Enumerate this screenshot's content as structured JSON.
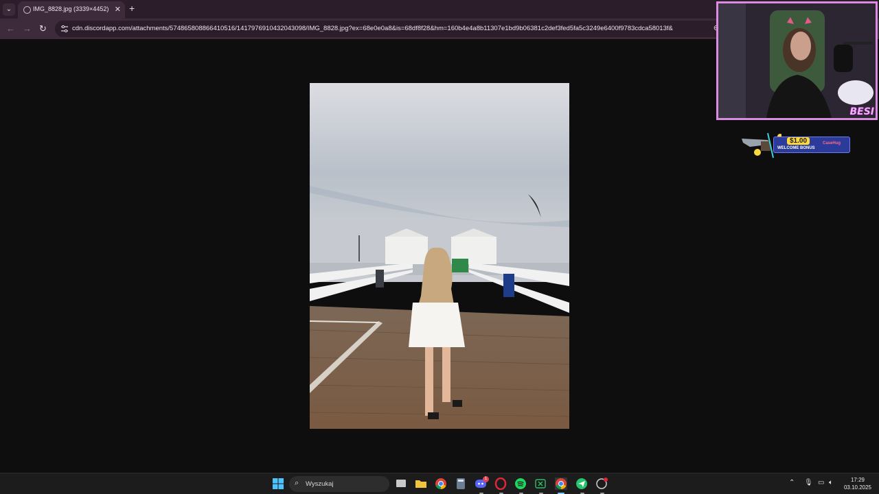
{
  "browser": {
    "tab": {
      "title": "IMG_8828.jpg (3339×4452)"
    },
    "address_bar": {
      "url": "cdn.discordapp.com/attachments/574865808866410516/1417976910432043098/IMG_8828.jpg?ex=68e0e0a8&is=68df8f28&hm=160b4e4a8b11307e1bd9b06381c2def3fed5fa5c3249e6400f9783cdca58013f&"
    }
  },
  "stream_overlay": {
    "webcam_brand": "BESI",
    "promo": {
      "amount": "$1.00",
      "label": "WELCOME BONUS",
      "logo": "CaseHug"
    }
  },
  "taskbar": {
    "search_placeholder": "Wyszukaj",
    "discord_badge": "1",
    "clock": {
      "time": "17:29",
      "date": "03.10.2025"
    }
  },
  "icons": {
    "tab_list": "chevron-down-icon",
    "new_tab": "plus-icon",
    "back": "arrow-left-icon",
    "forward": "arrow-right-icon",
    "reload": "reload-icon",
    "start": "windows-start-icon"
  },
  "colors": {
    "tabstrip": "#2b1d2a",
    "toolbar": "#3d2a3b",
    "viewer_bg": "#0e0e0e",
    "overlay_border": "#d98ce0",
    "taskbar": "#1c1c1c"
  }
}
